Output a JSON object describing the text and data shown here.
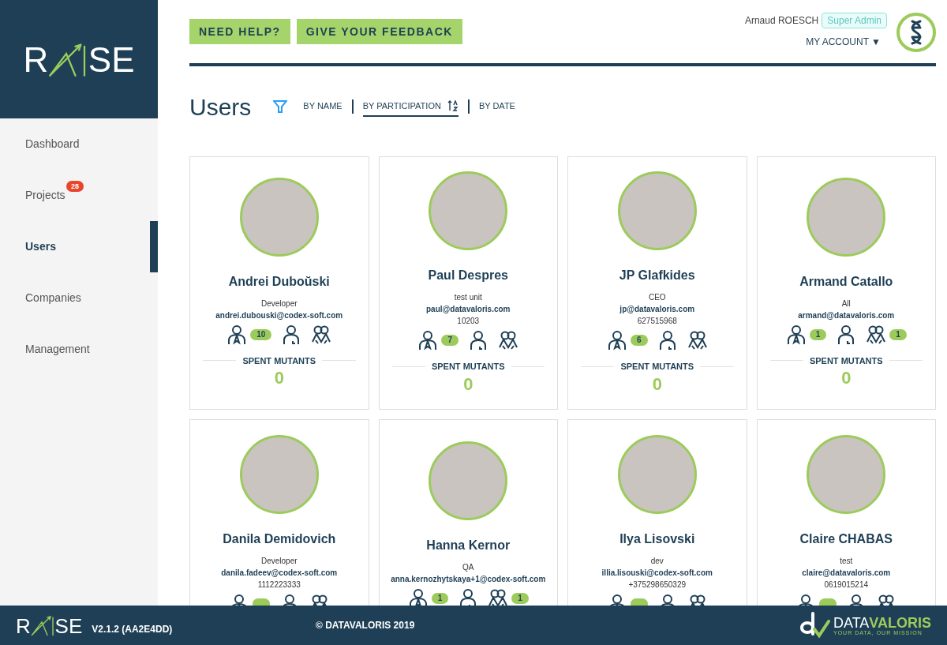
{
  "logo": {
    "left": "R",
    "right": "SE"
  },
  "sidebar": {
    "items": [
      {
        "label": "Dashboard",
        "selected": false
      },
      {
        "label": "Projects",
        "selected": false,
        "badge": "28"
      },
      {
        "label": "Users",
        "selected": true
      },
      {
        "label": "Companies",
        "selected": false
      },
      {
        "label": "Management",
        "selected": false
      }
    ]
  },
  "header": {
    "buttons": [
      "NEED HELP?",
      "GIVE YOUR FEEDBACK"
    ],
    "user_name": "Arnaud ROESCH",
    "role_badge": "Super Admin",
    "account_menu": "MY ACCOUNT",
    "account_caret": "▼"
  },
  "page_title": "Users",
  "sort_options": [
    {
      "label": "BY NAME",
      "selected": false
    },
    {
      "label": "BY PARTICIPATION",
      "selected": true
    },
    {
      "label": "BY DATE",
      "selected": false
    }
  ],
  "users": [
    {
      "name": "Andrei Duboŭski",
      "role": "Developer",
      "email": "andrei.dubouski@codex-soft.com",
      "stats": [
        {
          "kind": "tie",
          "count": "10"
        },
        {
          "kind": "person"
        },
        {
          "kind": "group"
        }
      ],
      "spent_label": "SPENT MUTANTS",
      "spent": "0"
    },
    {
      "name": "Paul Despres",
      "role": "test unit",
      "email": "paul@datavaloris.com",
      "phone": "10203",
      "stats": [
        {
          "kind": "tie",
          "count": "7"
        },
        {
          "kind": "person"
        },
        {
          "kind": "group"
        }
      ],
      "spent_label": "SPENT MUTANTS",
      "spent": "0"
    },
    {
      "name": "JP Glafkides",
      "role": "CEO",
      "email": "jp@datavaloris.com",
      "phone": "627515968",
      "stats": [
        {
          "kind": "tie",
          "count": "6"
        },
        {
          "kind": "person"
        },
        {
          "kind": "group"
        }
      ],
      "spent_label": "SPENT MUTANTS",
      "spent": "0"
    },
    {
      "name": "Armand Catallo",
      "role": "All",
      "email": "armand@datavaloris.com",
      "stats": [
        {
          "kind": "tie",
          "count": "1"
        },
        {
          "kind": "person"
        },
        {
          "kind": "group",
          "count": "1"
        }
      ],
      "spent_label": "SPENT MUTANTS",
      "spent": "0"
    },
    {
      "name": "Danila Demidovich",
      "role": "Developer",
      "email": "danila.fadeev@codex-soft.com",
      "phone": "1112223333",
      "stats": [
        {
          "kind": "tie",
          "badge": true
        },
        {
          "kind": "person"
        },
        {
          "kind": "group"
        }
      ]
    },
    {
      "name": "Hanna Kernor",
      "role": "QA",
      "email": "anna.kernozhytskaya+1@codex-soft.com",
      "stats": [
        {
          "kind": "tie",
          "count": "1"
        },
        {
          "kind": "person"
        },
        {
          "kind": "group",
          "count": "1"
        }
      ]
    },
    {
      "name": "Ilya Lisovski",
      "role": "dev",
      "email": "illia.lisouski@codex-soft.com",
      "phone": "+375298650329",
      "stats": [
        {
          "kind": "tie",
          "badge": true
        },
        {
          "kind": "person"
        },
        {
          "kind": "group"
        }
      ]
    },
    {
      "name": "Claire CHABAS",
      "role": "test",
      "email": "claire@datavaloris.com",
      "phone": "0619015214",
      "stats": [
        {
          "kind": "tie",
          "badge": true
        },
        {
          "kind": "person"
        },
        {
          "kind": "group"
        }
      ]
    }
  ],
  "footer": {
    "logo": {
      "left": "R",
      "right": "SE"
    },
    "version": "V2.1.2 (AA2E4DD)",
    "copyright": "© DATAVALORIS 2019",
    "brand": {
      "part1": "DATA",
      "part2": "VALORIS",
      "tagline": "YOUR DATA, OUR MISSION"
    }
  }
}
